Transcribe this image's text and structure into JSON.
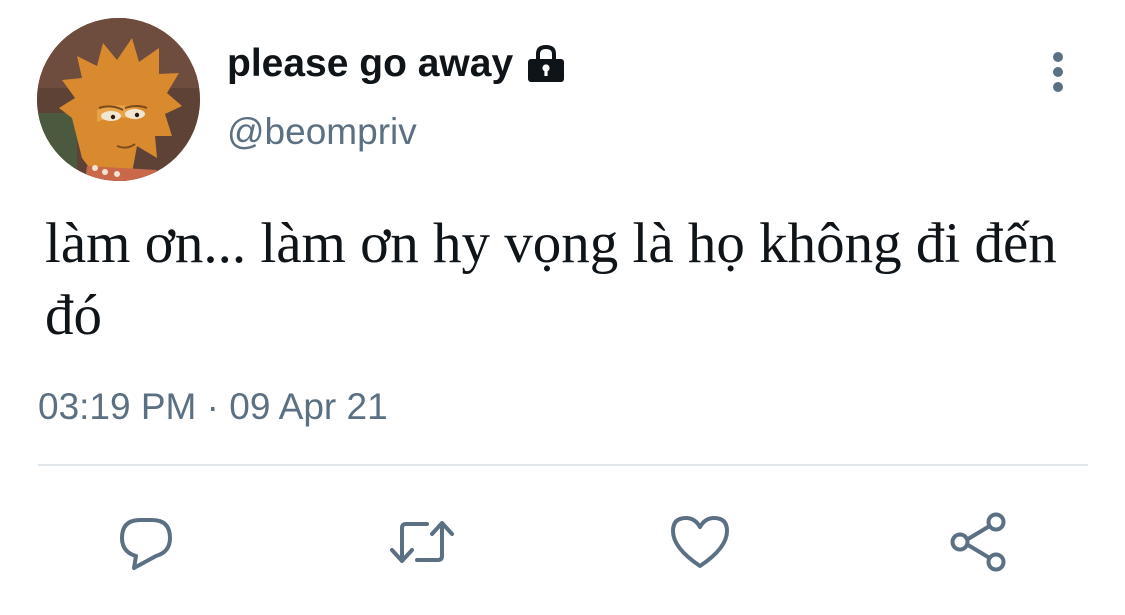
{
  "tweet": {
    "display_name": "please go away",
    "handle": "@beompriv",
    "text": "làm ơn... làm ơn hy vọng là họ không đi đến đó",
    "timestamp": "03:19 PM · 09 Apr 21",
    "protected_icon": "lock-icon",
    "avatar": "avatar-cartoon-girl"
  },
  "actions": [
    {
      "icon": "reply-icon"
    },
    {
      "icon": "retweet-icon"
    },
    {
      "icon": "like-icon"
    },
    {
      "icon": "share-icon"
    }
  ],
  "colors": {
    "text_primary": "#0f1419",
    "text_secondary": "#5b7083",
    "icon_gray": "#5b7083",
    "divider": "#e1e6ea"
  }
}
